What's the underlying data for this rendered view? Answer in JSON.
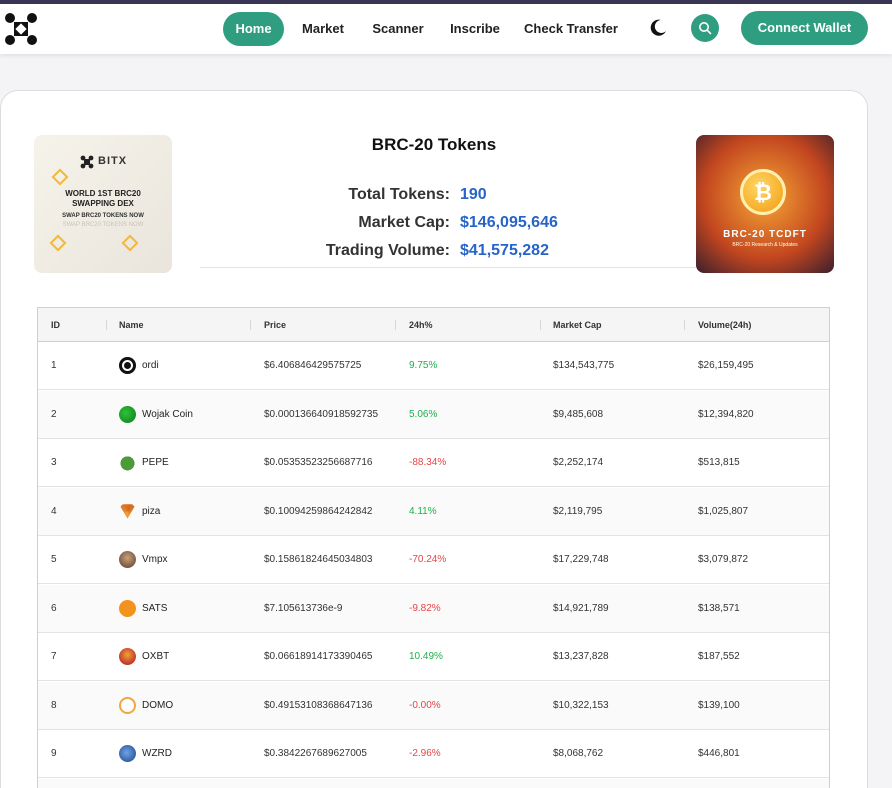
{
  "nav": {
    "links": [
      "Home",
      "Market",
      "Scanner",
      "Inscribe",
      "Check Transfer"
    ],
    "active": "Home",
    "connect_label": "Connect Wallet"
  },
  "colors": {
    "accent": "#2e9d80",
    "value_blue": "#2764c9",
    "positive": "#1fb04a",
    "negative": "#e54545"
  },
  "banner_left": {
    "brand": "BITX",
    "headline_1": "WORLD 1ST BRC20",
    "headline_2": "SWAPPING DEX",
    "sub": "SWAP BRC20 TOKENS NOW",
    "ghost": "SWAP BRC20 TOKENS NOW"
  },
  "banner_right": {
    "caption": "BRC-20 TCDFT",
    "sub": "BRC-20 Research & Updates"
  },
  "summary": {
    "title": "BRC-20 Tokens",
    "total_tokens_label": "Total Tokens:",
    "total_tokens": "190",
    "market_cap_label": "Market Cap:",
    "market_cap": "$146,095,646",
    "volume_label": "Trading Volume:",
    "volume": "$41,575,282"
  },
  "table": {
    "headers": [
      "ID",
      "Name",
      "Price",
      "24h%",
      "Market Cap",
      "Volume(24h)"
    ],
    "rows": [
      {
        "id": "1",
        "name": "ordi",
        "icon": "ordi-icon",
        "price": "$6.406846429575725",
        "change": "9.75%",
        "dir": "pos",
        "cap": "$134,543,775",
        "vol": "$26,159,495"
      },
      {
        "id": "2",
        "name": "Wojak Coin",
        "icon": "wojak-icon",
        "price": "$0.000136640918592735",
        "change": "5.06%",
        "dir": "pos",
        "cap": "$9,485,608",
        "vol": "$12,394,820"
      },
      {
        "id": "3",
        "name": "PEPE",
        "icon": "pepe-icon",
        "price": "$0.05353523256687716",
        "change": "-88.34%",
        "dir": "neg",
        "cap": "$2,252,174",
        "vol": "$513,815"
      },
      {
        "id": "4",
        "name": "piza",
        "icon": "pizza-icon",
        "price": "$0.10094259864242842",
        "change": "4.11%",
        "dir": "pos",
        "cap": "$2,119,795",
        "vol": "$1,025,807"
      },
      {
        "id": "5",
        "name": "Vmpx",
        "icon": "vmpx-avatar-icon",
        "price": "$0.15861824645034803",
        "change": "-70.24%",
        "dir": "neg",
        "cap": "$17,229,748",
        "vol": "$3,079,872"
      },
      {
        "id": "6",
        "name": "SATS",
        "icon": "sats-icon",
        "price": "$7.105613736e-9",
        "change": "-9.82%",
        "dir": "neg",
        "cap": "$14,921,789",
        "vol": "$138,571"
      },
      {
        "id": "7",
        "name": "OXBT",
        "icon": "oxbt-icon",
        "price": "$0.06618914173390465",
        "change": "10.49%",
        "dir": "pos",
        "cap": "$13,237,828",
        "vol": "$187,552"
      },
      {
        "id": "8",
        "name": "DOMO",
        "icon": "domo-icon",
        "price": "$0.49153108368647136",
        "change": "-0.00%",
        "dir": "neg",
        "cap": "$10,322,153",
        "vol": "$139,100"
      },
      {
        "id": "9",
        "name": "WZRD",
        "icon": "wzrd-icon",
        "price": "$0.3842267689627005",
        "change": "-2.96%",
        "dir": "neg",
        "cap": "$8,068,762",
        "vol": "$446,801"
      }
    ]
  }
}
